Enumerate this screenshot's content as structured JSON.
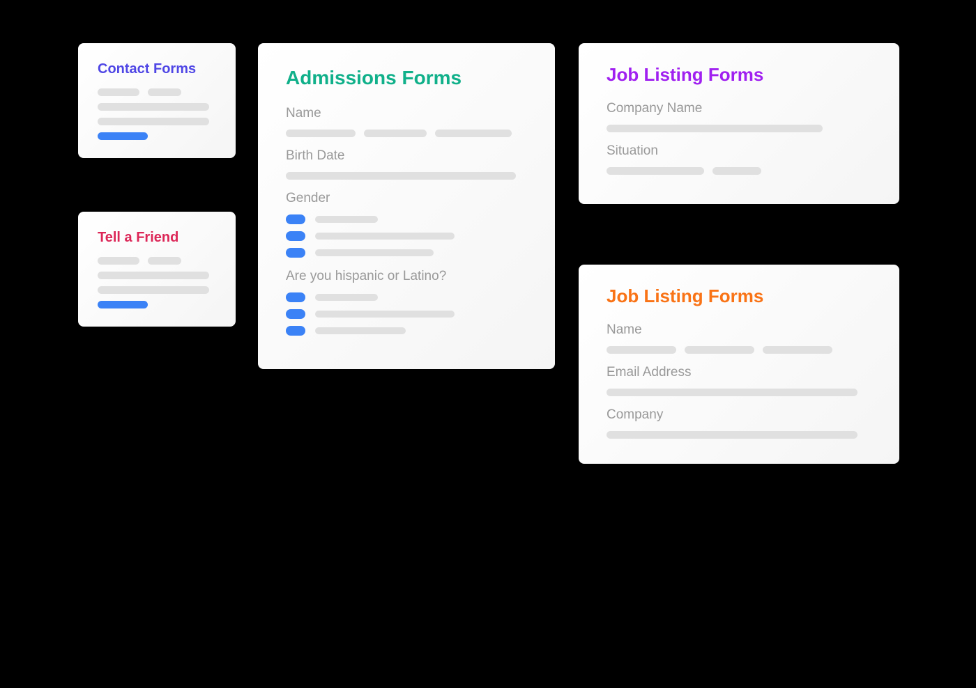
{
  "cards": {
    "contact": {
      "title": "Contact Forms"
    },
    "friend": {
      "title": "Tell a Friend"
    },
    "admissions": {
      "title": "Admissions Forms",
      "fields": {
        "name": "Name",
        "birth_date": "Birth Date",
        "gender": "Gender",
        "hispanic": "Are you hispanic or Latino?"
      }
    },
    "job_purple": {
      "title": "Job Listing Forms",
      "fields": {
        "company": "Company Name",
        "situation": "Situation"
      }
    },
    "job_orange": {
      "title": "Job Listing Forms",
      "fields": {
        "name": "Name",
        "email": "Email Address",
        "company": "Company"
      }
    }
  }
}
